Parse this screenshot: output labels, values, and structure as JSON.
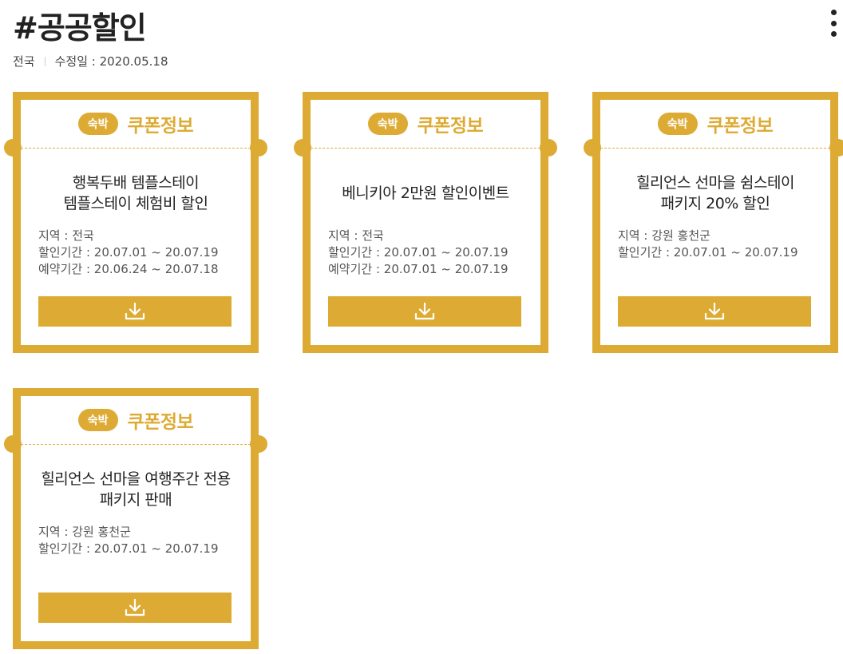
{
  "page": {
    "title": "#공공할인",
    "region": "전국",
    "modified": "수정일 : 2020.05.18"
  },
  "cards": [
    {
      "category": "숙박",
      "header": "쿠폰정보",
      "title_line1": "행복두배 템플스테이",
      "title_line2": "템플스테이 체험비 할인",
      "region": "지역 : 전국",
      "discount_period": "할인기간 : 20.07.01 ~ 20.07.19",
      "booking_period": "예약기간 : 20.06.24 ~ 20.07.18",
      "download_icon": "download-icon"
    },
    {
      "category": "숙박",
      "header": "쿠폰정보",
      "title_line1": "베니키아 2만원 할인이벤트",
      "title_line2": "",
      "region": "지역 : 전국",
      "discount_period": "할인기간 : 20.07.01 ~ 20.07.19",
      "booking_period": "예약기간 : 20.07.01 ~ 20.07.19",
      "download_icon": "download-icon"
    },
    {
      "category": "숙박",
      "header": "쿠폰정보",
      "title_line1": "힐리언스 선마을 쉼스테이",
      "title_line2": "패키지 20% 할인",
      "region": "지역 : 강원 홍천군",
      "discount_period": "할인기간 : 20.07.01 ~ 20.07.19",
      "booking_period": "",
      "download_icon": "download-icon"
    },
    {
      "category": "숙박",
      "header": "쿠폰정보",
      "title_line1": "힐리언스 선마을 여행주간 전용",
      "title_line2": "패키지 판매",
      "region": "지역 : 강원 홍천군",
      "discount_period": "할인기간 : 20.07.01 ~ 20.07.19",
      "booking_period": "",
      "download_icon": "download-icon"
    }
  ],
  "colors": {
    "accent": "#ddab34",
    "text": "#222222",
    "muted": "#555555"
  },
  "icons": {
    "more": "more-vertical-icon",
    "download": "download-icon"
  }
}
